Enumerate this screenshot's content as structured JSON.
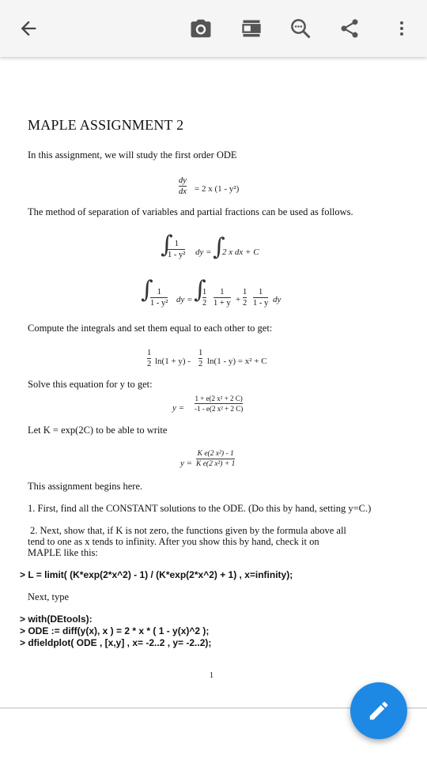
{
  "toolbar": {
    "back_icon": "arrow-left-icon",
    "camera_icon": "camera-icon",
    "layout_icon": "page-layout-icon",
    "search_icon": "search-in-document-icon",
    "share_icon": "share-icon",
    "more_icon": "more-vert-icon"
  },
  "doc": {
    "title": "MAPLE ASSIGNMENT 2",
    "intro": "In this assignment, we will study the first order ODE",
    "eq1": {
      "num": "dy",
      "den": "dx",
      "rhs": "= 2 x (1 - y²)"
    },
    "sep_text": "The method of separation of variables and partial fractions can be used as follows.",
    "eq2": {
      "num": "1",
      "den": "1 - y²",
      "mid": "dy =",
      "rhs": "2 x dx + C"
    },
    "eq3": {
      "num": "1",
      "den": "1 - y²",
      "mid": "dy =",
      "t1_num": "1",
      "t1_den": "2",
      "t2_num": "1",
      "t2_den": "1 + y",
      "plus": "+",
      "t3_num": "1",
      "t3_den": "2",
      "t4_num": "1",
      "t4_den": "1 - y",
      "tail": "dy"
    },
    "compute_text": "Compute the integrals and set them  equal to each other  to get:",
    "eq4": {
      "a_num": "1",
      "a_den": "2",
      "a_ln": "ln(1 + y) -",
      "b_num": "1",
      "b_den": "2",
      "b_ln": "ln(1 - y) = x² + C"
    },
    "solve_text": "Solve this equation for y to get:",
    "eq5": {
      "lhs": "y =",
      "num": "1 + e(2 x² + 2 C)",
      "den": "-1 - e(2 x² + 2 C)"
    },
    "let_text": "Let  K = exp(2C)  to be able to write",
    "eq6": {
      "lhs": "y =",
      "num": "K e(2 x²) - 1",
      "den": "K e(2 x²) + 1"
    },
    "begins_text": "This assignment begins here.",
    "q1": "1.  First, find all the CONSTANT  solutions to the ODE.  (Do this by hand, setting  y=C.)",
    "q2_line1": "2.  Next, show that, if K is not zero, the functions given by the formula above all",
    "q2_line2": "tend to one as x tends to infinity.  After you show this by hand, check it on",
    "q2_line3": "MAPLE like this:",
    "cmd1": "> L = limit(  (K*exp(2*x^2) - 1) / (K*exp(2*x^2) + 1) , x=infinity);",
    "next_type": "Next, type",
    "cmd2": "> with(DEtools):",
    "cmd3": "> ODE :=  diff(y(x), x ) = 2 * x * ( 1 - y(x)^2 );",
    "cmd4": "> dfieldplot( ODE ,  [x,y] , x= -2..2 , y= -2..2);",
    "page_number": "1"
  },
  "fab": {
    "icon": "edit-pencil-icon",
    "color": "#1e88e5"
  }
}
